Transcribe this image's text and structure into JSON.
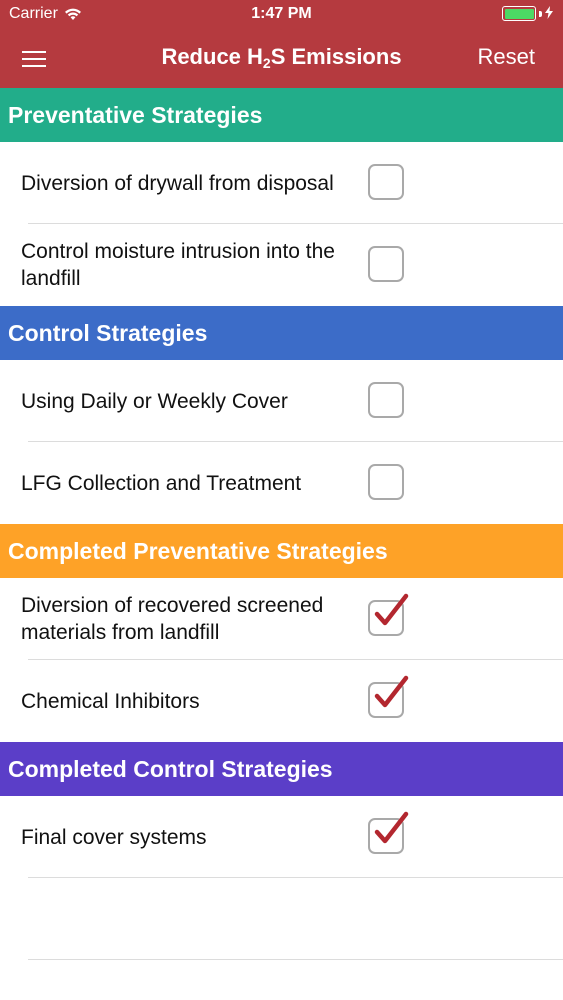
{
  "status_bar": {
    "carrier": "Carrier",
    "time": "1:47 PM"
  },
  "nav": {
    "title_prefix": "Reduce H",
    "title_sub": "2",
    "title_suffix": "S Emissions",
    "reset_label": "Reset"
  },
  "colors": {
    "nav_background": "#b53a3f",
    "checkmark": "#b3272f",
    "battery": "#4cd964"
  },
  "sections": [
    {
      "title": "Preventative Strategies",
      "color": "#22ad8a",
      "items": [
        {
          "label": "Diversion of drywall from disposal",
          "checked": false
        },
        {
          "label": "Control moisture intrusion into the landfill",
          "checked": false
        }
      ]
    },
    {
      "title": "Control Strategies",
      "color": "#3c6cc8",
      "items": [
        {
          "label": "Using Daily or Weekly Cover",
          "checked": false
        },
        {
          "label": "LFG Collection and Treatment",
          "checked": false
        }
      ]
    },
    {
      "title": "Completed Preventative Strategies",
      "color": "#fea227",
      "items": [
        {
          "label": "Diversion of recovered screened materials from landfill",
          "checked": true
        },
        {
          "label": "Chemical Inhibitors",
          "checked": true
        }
      ]
    },
    {
      "title": "Completed Control Strategies",
      "color": "#5b3ec8",
      "items": [
        {
          "label": "Final cover systems",
          "checked": true
        }
      ]
    }
  ]
}
